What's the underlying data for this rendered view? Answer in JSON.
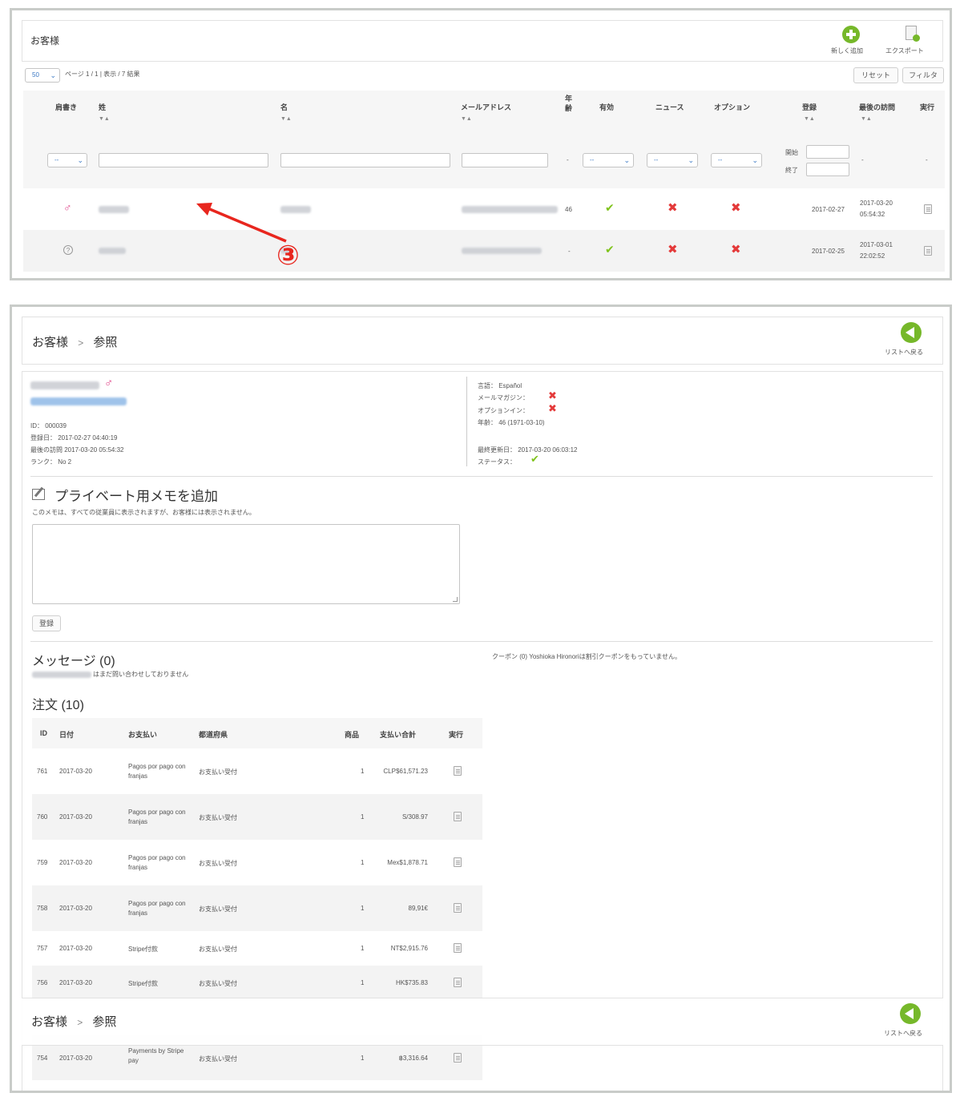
{
  "list": {
    "title": "お客様",
    "add_new": "新しく追加",
    "export": "エクスポート",
    "per_page": "50",
    "pagination": "ページ 1 / 1 | 表示 / 7 結果",
    "reset": "リセット",
    "filter": "フィルタ",
    "columns": [
      "肩書き",
      "姓",
      "名",
      "メールアドレス",
      "年齢",
      "有効",
      "ニュース",
      "オプション",
      "登録",
      "最後の訪問",
      "実行"
    ],
    "sort_glyph": "▼▲",
    "filter_select": "--",
    "date_from": "開始",
    "date_to": "終了",
    "dash": "-",
    "rows": [
      {
        "gender_icon": "♂",
        "age": "46",
        "registered": "2017-02-27",
        "last_visit": "2017-03-20",
        "last_visit_time": "05:54:32"
      },
      {
        "gender_icon": "?",
        "age": "-",
        "registered": "2017-02-25",
        "last_visit": "2017-03-01",
        "last_visit_time": "22:02:52"
      }
    ],
    "annotation": "③"
  },
  "detail": {
    "breadcrumb_root": "お客様",
    "breadcrumb_sep": ">",
    "breadcrumb_current": "参照",
    "back": "リストへ戻る",
    "gender_icon": "♂",
    "id_line": "ID： 000039",
    "registered_line": "登録日： 2017-02-27 04:40:19",
    "last_visit_line": "最後の訪問 2017-03-20 05:54:32",
    "rank_line": "ランク： No 2",
    "language_line": "言語： Español",
    "newsletter_label": "メールマガジン：",
    "optin_label": "オプションイン：",
    "age_line": "年齢： 46 (1971-03-10)",
    "updated_line": "最終更新日： 2017-03-20 06:03:12",
    "status_label": "ステータス：",
    "memo_title": "プライベート用メモを追加",
    "memo_hint": "このメモは、すべての従業員に表示されますが、お客様には表示されません。",
    "save": "登録",
    "messages_title": "メッセージ (0)",
    "messages_text": "はまだ問い合わせしておりません",
    "coupon_text": "クーポン (0) Yoshioka Hironoriは割引クーポンをもっていません。",
    "orders_title": "注文 (10)",
    "order_columns": [
      "ID",
      "日付",
      "お支払い",
      "都道府県",
      "商品",
      "支払い合計",
      "実行"
    ],
    "orders": [
      {
        "id": "761",
        "date": "2017-03-20",
        "payment": "Pagos por pago con franjas",
        "status": "お支払い受付",
        "qty": "1",
        "total": "CLP$61,571.23"
      },
      {
        "id": "760",
        "date": "2017-03-20",
        "payment": "Pagos por pago con franjas",
        "status": "お支払い受付",
        "qty": "1",
        "total": "S/308.97"
      },
      {
        "id": "759",
        "date": "2017-03-20",
        "payment": "Pagos por pago con franjas",
        "status": "お支払い受付",
        "qty": "1",
        "total": "Mex$1,878.71"
      },
      {
        "id": "758",
        "date": "2017-03-20",
        "payment": "Pagos por pago con franjas",
        "status": "お支払い受付",
        "qty": "1",
        "total": "89,91€"
      },
      {
        "id": "757",
        "date": "2017-03-20",
        "payment": "Stripe付款",
        "status": "お支払い受付",
        "qty": "1",
        "total": "NT$2,915.76"
      },
      {
        "id": "756",
        "date": "2017-03-20",
        "payment": "Stripe付款",
        "status": "お支払い受付",
        "qty": "1",
        "total": "HK$735.83"
      },
      {
        "id": "754",
        "date": "2017-03-20",
        "payment": "Payments by Stripe pay",
        "status": "お支払い受付",
        "qty": "1",
        "total": "฿3,316.64"
      }
    ]
  },
  "colors": {
    "accent_green": "#76b82a",
    "error_red": "#e43a3a",
    "link_blue": "#3a78c4",
    "male_pink": "#e0468a",
    "annotation_red": "#e8261e"
  }
}
